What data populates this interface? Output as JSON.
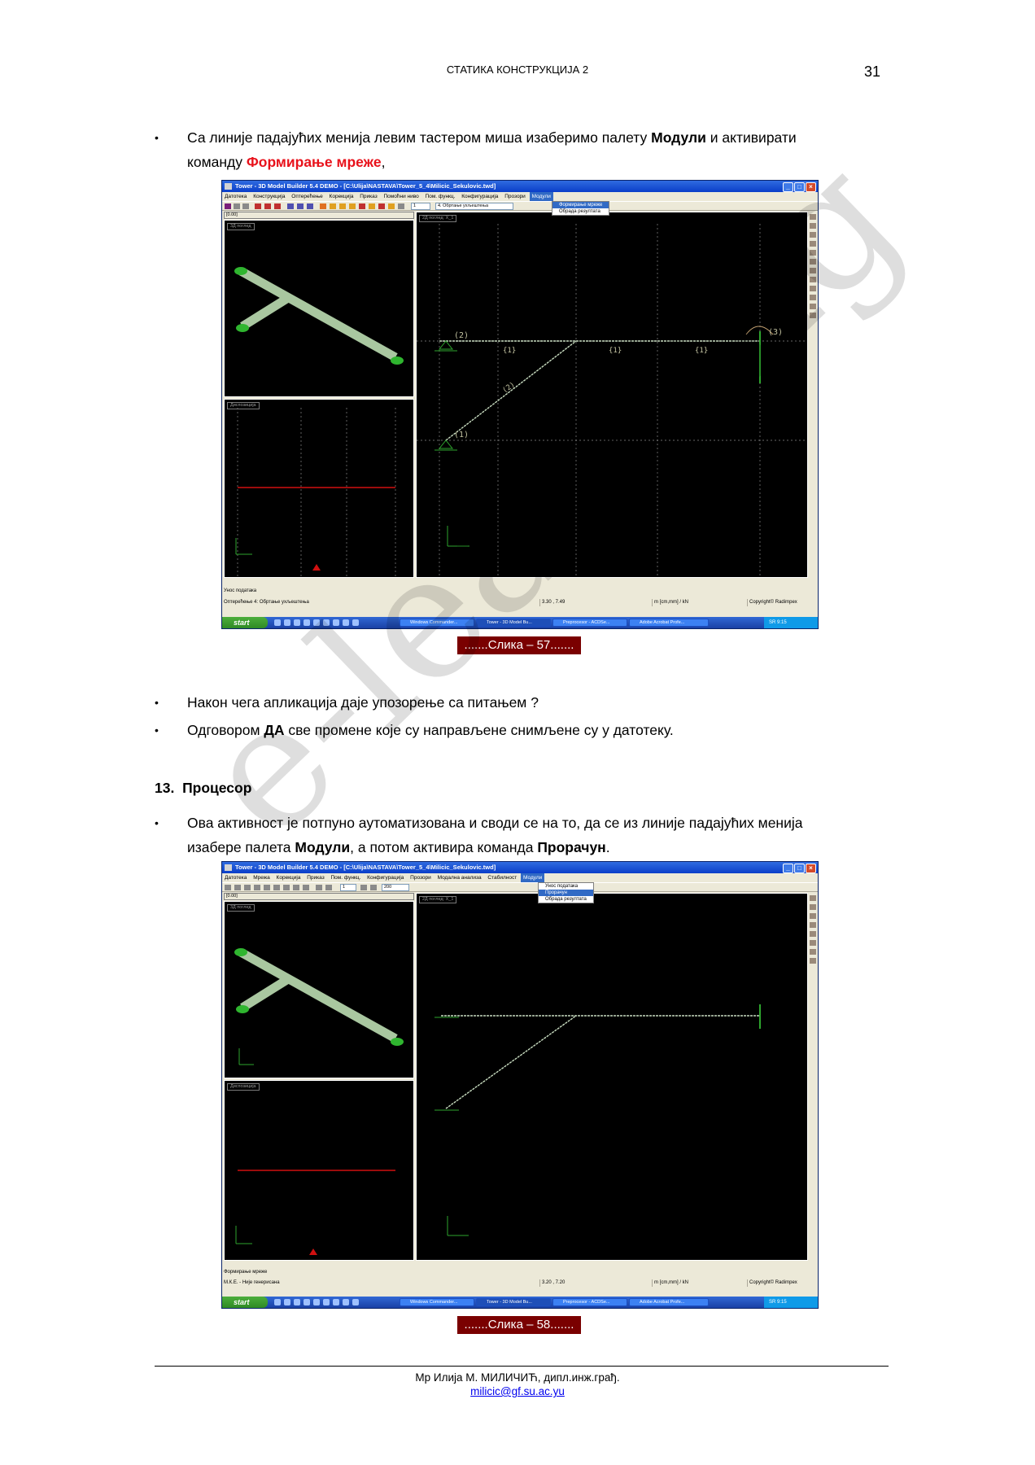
{
  "header": {
    "title": "СТАТИКА КОНСТРУКЦИЈА 2",
    "page_number": "31"
  },
  "bullets": {
    "b1_part1": "Са линије падајућих менија левим тастером миша изаберимо палету ",
    "b1_bold": "Модули",
    "b1_part2": " и активирати",
    "b1_part3": "команду ",
    "b1_red": "Формирање мреже",
    "b1_end": ",",
    "b2": "Након чега апликација даје упозорење са питањем ?",
    "b3_part1": "Одговором ",
    "b3_bold": "ДА",
    "b3_part2": " све промене које су направљене снимљене су у датотеку.",
    "b4_part1": "Ова активност је потпуно аутоматизована и своди се на то, да се из линије падајућих менија",
    "b4_part2": "изабере палета ",
    "b4_bold1": "Модули",
    "b4_part3": ", а потом активира команда ",
    "b4_bold2": "Прорачун",
    "b4_end": ".",
    "bullet_glyph": "•"
  },
  "section": {
    "number": "13.",
    "title": "Процесор"
  },
  "captions": {
    "fig57": ".......Слика – 57.......",
    "fig58": ".......Слика – 58......."
  },
  "watermark": "e-learning",
  "footer": {
    "author": "Мр Илија М. МИЛИЧИЋ, дипл.инж.грађ.",
    "email": "milicic@gf.su.ac.yu"
  },
  "screenshot1": {
    "title": "Tower - 3D Model Builder 5.4 DEMO - [C:\\Ulija\\NASTAVA\\Tower_5_4\\Milicic_Sekulovic.twd]",
    "menu": [
      "Датотека",
      "Конструкција",
      "Оптерећење",
      "Корекција",
      "Приказ",
      "Помоћни ниво",
      "Пом. функц.",
      "Конфигурација",
      "Прозори",
      "Модули"
    ],
    "dropdown": [
      "Формирање мреже",
      "Обрада резултата"
    ],
    "toolbar_field1": "1",
    "toolbar_field2": "4. Обртање ухљештења",
    "left_top_field": "[0.00]",
    "pane_3d_label": "3Д поглед",
    "pane_disp_label": "Диспозиција",
    "pane_main_label": "2Д поглед: Х_1",
    "node_labels": [
      "(2)",
      "(1)",
      "(3)",
      "{1}",
      "{1}",
      "{1}",
      "(2)"
    ],
    "status_left": "Унос података",
    "status_bottom": "Оптерећење 4: Обртање ухљештења",
    "status_coords": "3.30 , 7.49",
    "status_units": "m [cm,mm] / kN",
    "status_copyright": "Copyright© Radimpex",
    "taskbar": {
      "start": "start",
      "tasks": [
        "Windows Commander...",
        "Tower - 3D Model Bu...",
        "Preprocesor - ACDSe...",
        "Adobe Acrobat Profe..."
      ],
      "tray": "SR  9:15"
    }
  },
  "screenshot2": {
    "title": "Tower - 3D Model Builder 5.4 DEMO - [C:\\Ulija\\NASTAVA\\Tower_5_4\\Milicic_Sekulovic.twd]",
    "menu": [
      "Датотека",
      "Мрежа",
      "Корекција",
      "Приказ",
      "Пом. функц.",
      "Конфигурација",
      "Прозори",
      "Модална анализа",
      "Стабилност",
      "Модули"
    ],
    "dropdown": [
      "Унос података",
      "Прорачун",
      "Обрада резултата"
    ],
    "toolbar_field1": "1",
    "toolbar_field2": "200",
    "left_top_field": "[0.00]",
    "pane_3d_label": "3Д поглед",
    "pane_disp_label": "Диспозиција",
    "pane_main_label": "2Д поглед: Х_1",
    "status_left": "Формирање мреже",
    "status_bottom": "М.К.Е. - Није генерисана",
    "status_coords": "3.20 , 7.20",
    "status_units": "m [cm,mm] / kN",
    "status_copyright": "Copyright© Radimpex",
    "taskbar": {
      "start": "start",
      "tasks": [
        "Windows Commander...",
        "Tower - 3D Model Bu...",
        "Preprocesor - ACDSe...",
        "Adobe Acrobat Profe..."
      ],
      "tray": "SR  9:15"
    }
  }
}
